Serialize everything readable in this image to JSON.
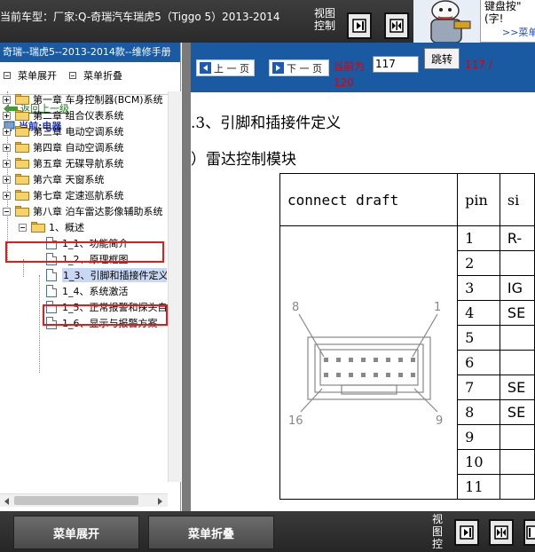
{
  "topbar": {
    "title": "当前车型：厂家:Q-奇瑞汽车瑞虎5（Tiggo 5）2013-2014",
    "view_label": "视图控制",
    "tip_text": "键盘按\"(字!",
    "tip_link": ">>菜单"
  },
  "sidebar": {
    "header": "奇瑞--瑞虎5--2013-2014款--维修手册",
    "expand_label": "菜单展开",
    "collapse_label": "菜单折叠",
    "back_label": "返回上一级",
    "current_label": "当前:电器",
    "tree": [
      {
        "label": "第一章 车身控制器(BCM)系统"
      },
      {
        "label": "第二章 组合仪表系统"
      },
      {
        "label": "第三章 电动空调系统"
      },
      {
        "label": "第四章 自动空调系统"
      },
      {
        "label": "第五章 无碟导航系统"
      },
      {
        "label": "第六章 天窗系统"
      },
      {
        "label": "第七章 定速巡航系统"
      },
      {
        "label": "第八章 泊车雷达影像辅助系统"
      },
      {
        "label": "1、概述"
      },
      {
        "label": "1_1、功能简介"
      },
      {
        "label": "1_2、原理框图"
      },
      {
        "label": "1_3、引脚和插接件定义"
      },
      {
        "label": "1_4、系统激活"
      },
      {
        "label": "1_5、正常报警和探头自"
      },
      {
        "label": "1_6、显示与报警方案"
      }
    ]
  },
  "nav": {
    "prev_label": "上 一 页",
    "next_label": "下 一 页",
    "current_prefix": "当前为",
    "page_value": "117",
    "jump_label": "跳转",
    "total_part1": "117 /",
    "total_part2": "120"
  },
  "content": {
    "heading1": ".3、引脚和插接件定义",
    "heading2": "）雷达控制模块",
    "table_header": [
      "connect draft",
      "pin",
      "si"
    ],
    "pins": [
      "1",
      "2",
      "3",
      "4",
      "5",
      "6",
      "7",
      "8",
      "9",
      "10",
      "11"
    ],
    "signals": [
      "R-",
      "",
      "IG",
      "SE",
      "",
      "",
      "SE",
      "SE",
      "",
      "",
      ""
    ],
    "connector_labels": {
      "top_left": "8",
      "top_right": "1",
      "bottom_left": "16",
      "bottom_right": "9"
    }
  },
  "bottombar": {
    "expand_label": "菜单展开",
    "collapse_label": "菜单折叠",
    "view_label": "视图控"
  }
}
